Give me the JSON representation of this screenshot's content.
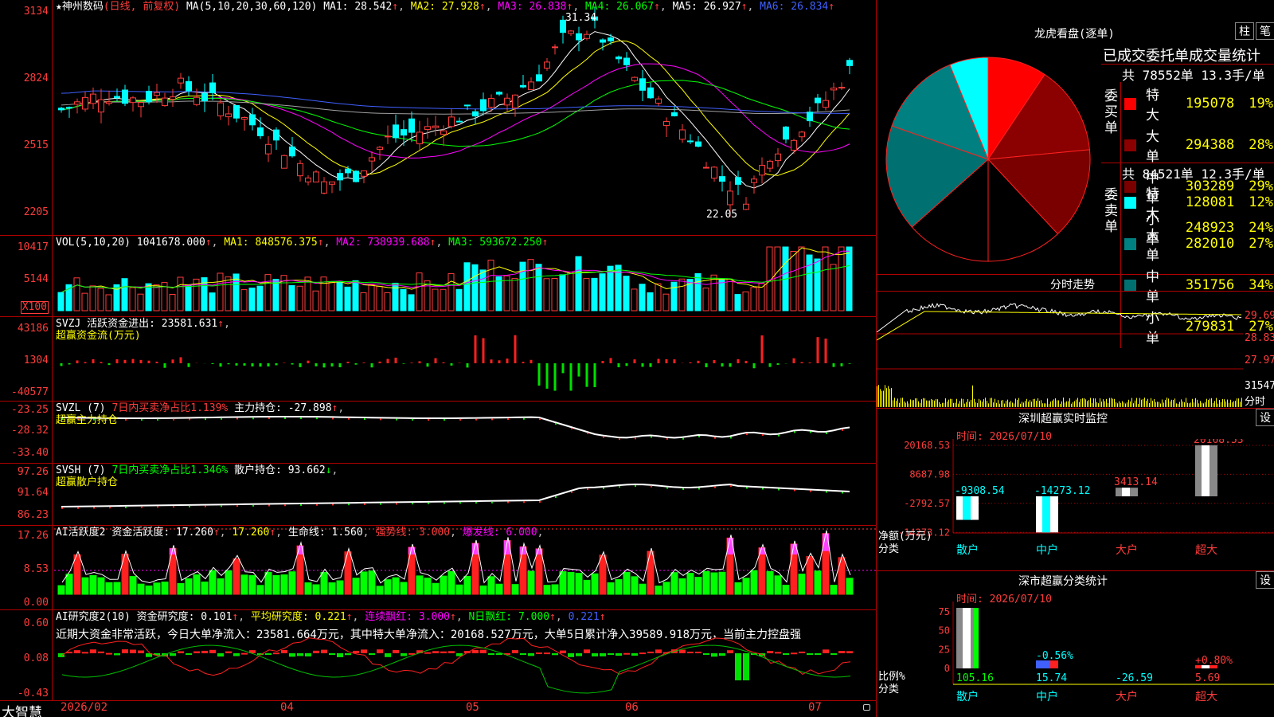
{
  "colors": {
    "up": "#ff3c3c",
    "down": "#00ffff",
    "ma1": "#ffffff",
    "ma2": "#ffff00",
    "ma3": "#ff00ff",
    "ma4": "#00ff00",
    "ma5": "#a0a0a0",
    "ma6": "#4060ff",
    "border": "#b00000"
  },
  "price_panel": {
    "stock_name": "神州数码",
    "mode": "(日线, 前复权)",
    "ma_label": "MA(5,10,20,30,60,120)",
    "ma": [
      {
        "label": "MA1:",
        "value": "28.542"
      },
      {
        "label": "MA2:",
        "value": "27.928"
      },
      {
        "label": "MA3:",
        "value": "26.838"
      },
      {
        "label": "MA4:",
        "value": "26.067"
      },
      {
        "label": "MA5:",
        "value": "26.927"
      },
      {
        "label": "MA6:",
        "value": "26.834"
      }
    ],
    "yticks": [
      "3134",
      "2824",
      "2515",
      "2205"
    ],
    "high_mark": "31.34",
    "low_mark": "22.05",
    "star_icon": "★",
    "arrow": "↑"
  },
  "vol_panel": {
    "label": "VOL(5,10,20)",
    "vol": "1041678.000",
    "ma1": "MA1: 848576.375",
    "ma2": "MA2: 738939.688",
    "ma3": "MA3: 593672.250",
    "yticks": [
      "10417",
      "5144"
    ],
    "unit": "X100"
  },
  "svzj_panel": {
    "label": "SVZJ",
    "title": "活跃资金进出: 23581.631",
    "sub": "超赢资金流(万元)",
    "yticks": [
      "43186",
      "1304",
      "-40577"
    ]
  },
  "svzl_panel": {
    "label": "SVZL (7)",
    "text1": "7日内买卖净占比1.139%",
    "text2": "主力持仓: -27.898",
    "sub": "超赢主力持仓",
    "yticks": [
      "-23.25",
      "-28.32",
      "-33.40"
    ]
  },
  "svsh_panel": {
    "label": "SVSH (7)",
    "text1": "7日内买卖净占比1.346%",
    "text2": "散户持仓: 93.662",
    "sub": "超赢散户持仓",
    "yticks": [
      "97.26",
      "91.64",
      "86.23"
    ]
  },
  "ai1_panel": {
    "label": "AI活跃度2",
    "t1": "资金活跃度: 17.260",
    "t2": "17.260",
    "t3": "生命线: 1.560",
    "t4": "强势线: 3.000",
    "t5": "爆发线: 6.000",
    "yticks": [
      "17.26",
      "8.53",
      "0.00"
    ]
  },
  "ai2_panel": {
    "label": "AI研究度2(10)",
    "t1": "资金研究度: 0.101",
    "t2": "平均研究度: 0.221",
    "t3": "连续飘红: 3.000",
    "t4": "N日飘红: 7.000",
    "t5": "0.221",
    "comment": "近期大资金非常活跃，今日大单净流入：23581.664万元，其中特大单净流入：20168.527万元，大单5日累计净入39589.918万元，当前主力控盘强",
    "yticks": [
      "0.60",
      "0.08",
      "-0.43"
    ]
  },
  "xaxis": {
    "brand": "大智慧",
    "labels": [
      "2026/02",
      "04",
      "05",
      "06",
      "07"
    ]
  },
  "pie": {
    "title": "龙虎看盘(逐单)",
    "btn1": "柱",
    "btn2": "笔",
    "table_title": "已成交委托单成交量统计",
    "buy": {
      "side_label": "委买单",
      "summary": "共 78552单 13.3手/单",
      "rows": [
        {
          "name": "特大",
          "value": "195078",
          "pct": "19%",
          "color": "#ff0000"
        },
        {
          "name": "大单",
          "value": "294388",
          "pct": "28%",
          "color": "#8b0000"
        },
        {
          "name": "中单",
          "value": "303289",
          "pct": "29%",
          "color": "#7a0000"
        },
        {
          "name": "小单",
          "value": "248923",
          "pct": "24%",
          "color": "#000000"
        }
      ]
    },
    "sell": {
      "side_label": "委卖单",
      "summary": "共 84521单 12.3手/单",
      "rows": [
        {
          "name": "特大",
          "value": "128081",
          "pct": "12%",
          "color": "#00ffff"
        },
        {
          "name": "大单",
          "value": "282010",
          "pct": "27%",
          "color": "#008080"
        },
        {
          "name": "中单",
          "value": "351756",
          "pct": "34%",
          "color": "#007070"
        },
        {
          "name": "小单",
          "value": "279831",
          "pct": "27%",
          "color": "#000000"
        }
      ]
    }
  },
  "intraday": {
    "title": "分时走势",
    "yticks": [
      "29.69",
      "28.83",
      "27.97"
    ],
    "vol_label": "31547",
    "vol_unit": "分时"
  },
  "monitor": {
    "title": "深圳超赢实时监控",
    "btn": "设",
    "time": "时间: 2026/07/10",
    "yticks": [
      "20168.53",
      "8687.98",
      "-2792.57",
      "-14273.12"
    ],
    "ylabel": "净额(万元)",
    "xlabel": "分类",
    "cats": [
      "散户",
      "中户",
      "大户",
      "超大"
    ],
    "values": [
      -9308.54,
      -14273.12,
      3413.14,
      20168.53
    ],
    "labels": [
      "-9308.54",
      "-14273.12",
      "3413.14",
      "20168.53"
    ]
  },
  "classify": {
    "title": "深市超赢分类统计",
    "btn": "设",
    "time": "时间: 2026/07/10",
    "yticks": [
      "75",
      "50",
      "25",
      "0"
    ],
    "ylabel": "比例%",
    "xlabel": "分类",
    "cats": [
      "散户",
      "中户",
      "大户",
      "超大"
    ],
    "values": [
      105.16,
      15.74,
      -26.59,
      5.69
    ],
    "bar_labels": [
      "",
      "-0.56%",
      "",
      "+0.80%"
    ],
    "bottom_labels": [
      "105.16",
      "15.74",
      "-26.59",
      "5.69"
    ]
  }
}
